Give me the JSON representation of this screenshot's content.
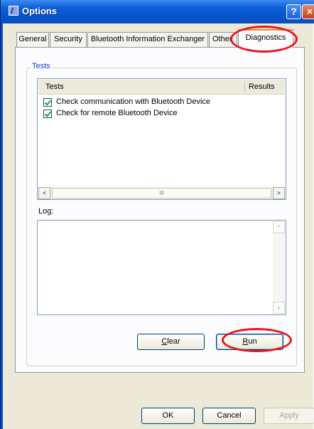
{
  "window": {
    "title": "Options"
  },
  "titlebar_buttons": {
    "help": "?",
    "close": "×"
  },
  "tabs": [
    {
      "label": "General"
    },
    {
      "label": "Security"
    },
    {
      "label": "Bluetooth Information Exchanger"
    },
    {
      "label": "Other"
    },
    {
      "label": "Diagnostics"
    }
  ],
  "active_tab": "Diagnostics",
  "tests_group": {
    "label": "Tests",
    "columns": {
      "tests": "Tests",
      "results": "Results"
    },
    "rows": [
      {
        "label": "Check communication with Bluetooth Device",
        "checked": true
      },
      {
        "label": "Check for remote Bluetooth Device",
        "checked": true
      }
    ],
    "scroll_left": "<",
    "scroll_right": ">",
    "scroll_grip": "III"
  },
  "log": {
    "label": "Log:",
    "content": "",
    "scroll_up": "^",
    "scroll_down": "v"
  },
  "actions": {
    "clear": {
      "mnemonic": "C",
      "rest": "lear"
    },
    "run": {
      "mnemonic": "R",
      "rest": "un"
    }
  },
  "dialog_buttons": {
    "ok": "OK",
    "cancel": "Cancel",
    "apply": "Apply"
  },
  "annotation_color": "#e8151b"
}
